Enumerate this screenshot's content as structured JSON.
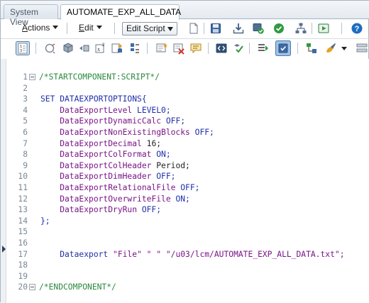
{
  "tabs": [
    {
      "label": "System View"
    },
    {
      "label": "AUTOMATE_EXP_ALL_DATA"
    }
  ],
  "toolbar": {
    "actions_label": "Actions",
    "actions_mnemonic": "A",
    "actions_rest": "ctions",
    "edit_label": "Edit",
    "edit_mnemonic": "E",
    "edit_rest": "dit",
    "mode_select": "Edit Script"
  },
  "editor": {
    "lines": [
      {
        "n": "1",
        "parts": [
          {
            "t": "/*STARTCOMPONENT:SCRIPT*/",
            "c": "cmt"
          }
        ]
      },
      {
        "n": "2",
        "parts": []
      },
      {
        "n": "3",
        "parts": [
          {
            "t": "SET DATAEXPORTOPTIONS{",
            "c": "kw"
          }
        ]
      },
      {
        "n": "4",
        "parts": [
          {
            "t": "    DataExportLevel ",
            "c": "prop"
          },
          {
            "t": "LEVEL0;",
            "c": "val"
          }
        ]
      },
      {
        "n": "5",
        "parts": [
          {
            "t": "    DataExportDynamicCalc ",
            "c": "prop"
          },
          {
            "t": "OFF;",
            "c": "val"
          }
        ]
      },
      {
        "n": "6",
        "parts": [
          {
            "t": "    DataExportNonExistingBlocks ",
            "c": "prop"
          },
          {
            "t": "OFF;",
            "c": "val"
          }
        ]
      },
      {
        "n": "7",
        "parts": [
          {
            "t": "    DataExportDecimal ",
            "c": "prop"
          },
          {
            "t": "16;",
            "c": "plain"
          }
        ]
      },
      {
        "n": "8",
        "parts": [
          {
            "t": "    DataExportColFormat ",
            "c": "prop"
          },
          {
            "t": "ON;",
            "c": "val"
          }
        ]
      },
      {
        "n": "9",
        "parts": [
          {
            "t": "    DataExportColHeader ",
            "c": "prop"
          },
          {
            "t": "Period;",
            "c": "plain"
          }
        ]
      },
      {
        "n": "10",
        "parts": [
          {
            "t": "    DataExportDimHeader ",
            "c": "prop"
          },
          {
            "t": "OFF;",
            "c": "val"
          }
        ]
      },
      {
        "n": "11",
        "parts": [
          {
            "t": "    DataExportRelationalFile ",
            "c": "prop"
          },
          {
            "t": "OFF;",
            "c": "val"
          }
        ]
      },
      {
        "n": "12",
        "parts": [
          {
            "t": "    DataExportOverwriteFile ",
            "c": "prop"
          },
          {
            "t": "ON;",
            "c": "val"
          }
        ]
      },
      {
        "n": "13",
        "parts": [
          {
            "t": "    DataExportDryRun ",
            "c": "prop"
          },
          {
            "t": "OFF;",
            "c": "val"
          }
        ]
      },
      {
        "n": "14",
        "parts": [
          {
            "t": "};",
            "c": "kw"
          }
        ]
      },
      {
        "n": "15",
        "parts": []
      },
      {
        "n": "16",
        "parts": []
      },
      {
        "n": "17",
        "parts": [
          {
            "t": "    Dataexport ",
            "c": "kw"
          },
          {
            "t": "\"File\" \" \" \"/u03/lcm/AUTOMATE_EXP_ALL_DATA.txt\";",
            "c": "str"
          }
        ]
      },
      {
        "n": "18",
        "parts": []
      },
      {
        "n": "19",
        "parts": []
      },
      {
        "n": "20",
        "parts": [
          {
            "t": "/*ENDCOMPONENT*/",
            "c": "cmt"
          }
        ]
      }
    ],
    "foldable": [
      "1",
      "20"
    ]
  },
  "icons": {
    "row1": [
      "new-page-icon",
      "save-icon",
      "download-icon",
      "validate-icon",
      "check-icon",
      "hierarchy-icon",
      "launch-icon",
      "help-icon"
    ],
    "row2": [
      "line-numbers-icon",
      "function-icon",
      "member-icon",
      "variable-icon",
      "formula-icon",
      "smartlist-icon",
      "insert-comment-icon",
      "remove-comment-icon",
      "comment-icon",
      "code-block-icon",
      "format-icon",
      "collapse-icon",
      "toggle-view-icon",
      "tree-icon",
      "paint-icon"
    ]
  },
  "colors": {
    "comment": "#2b8a3e",
    "keyword": "#1f2fa8",
    "property": "#7a1487"
  }
}
